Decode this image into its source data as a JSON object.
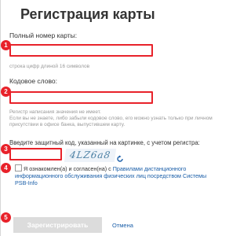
{
  "page": {
    "title": "Регистрация карты",
    "card": {
      "label": "Полный номер карты:",
      "value": "",
      "hint": "строка цифр длиной 16 символов"
    },
    "code": {
      "label": "Кодовое слово:",
      "value": "",
      "hint": "Регистр написания значения не имеет.\nЕсли вы не знаете, либо забыли кодовое слово, его можно узнать только при личном присутствии в офисе банка, выпустившем карту."
    },
    "captcha": {
      "label": "Введите защитный код, указанный на картинке, с учетом регистра:",
      "value": "",
      "image_text": "4LZ6a8"
    },
    "agreement": {
      "prefix": "Я ознакомлен(а) и согласен(на) с ",
      "link": "Правилами дистанционного информационного обслуживания физических лиц посредством Системы PSB-Info",
      "checked": false
    },
    "buttons": {
      "submit": "Зарегистрировать",
      "cancel": "Отмена"
    },
    "markers": [
      "1",
      "2",
      "3",
      "4",
      "5"
    ]
  },
  "colors": {
    "accent": "#e8222a",
    "link": "#1a5ea8",
    "disabled_button": "#dcdcdc"
  }
}
